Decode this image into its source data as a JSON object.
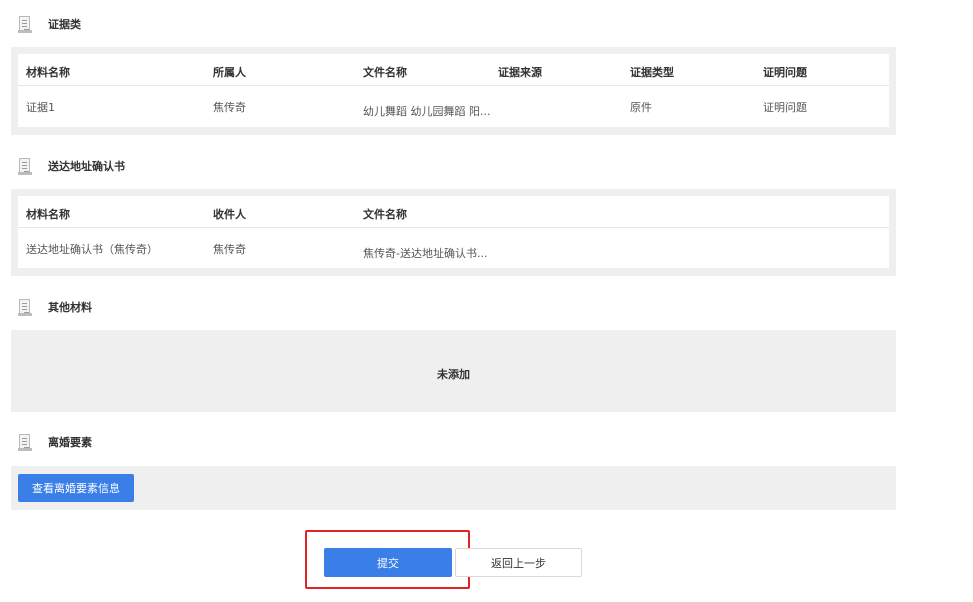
{
  "evidence": {
    "title": "证据类",
    "headers": [
      "材料名称",
      "所属人",
      "文件名称",
      "证据来源",
      "证据类型",
      "证明问题"
    ],
    "row": {
      "name": "证据1",
      "owner": "焦传奇",
      "file": "幼儿舞蹈 幼儿园舞蹈 阳...",
      "source": "",
      "type": "原件",
      "issue": "证明问题"
    }
  },
  "service_address": {
    "title": "送达地址确认书",
    "headers": [
      "材料名称",
      "收件人",
      "文件名称"
    ],
    "row": {
      "name": "送达地址确认书（焦传奇）",
      "recipient": "焦传奇",
      "file": "焦传奇-送达地址确认书..."
    }
  },
  "other_materials": {
    "title": "其他材料",
    "empty_text": "未添加"
  },
  "divorce_elements": {
    "title": "离婚要素",
    "view_button": "查看离婚要素信息"
  },
  "actions": {
    "submit": "提交",
    "back": "返回上一步"
  },
  "colors": {
    "primary": "#3a7fe8",
    "link": "#2f76d6",
    "highlight": "#e02424",
    "panel_bg": "#efefef"
  }
}
